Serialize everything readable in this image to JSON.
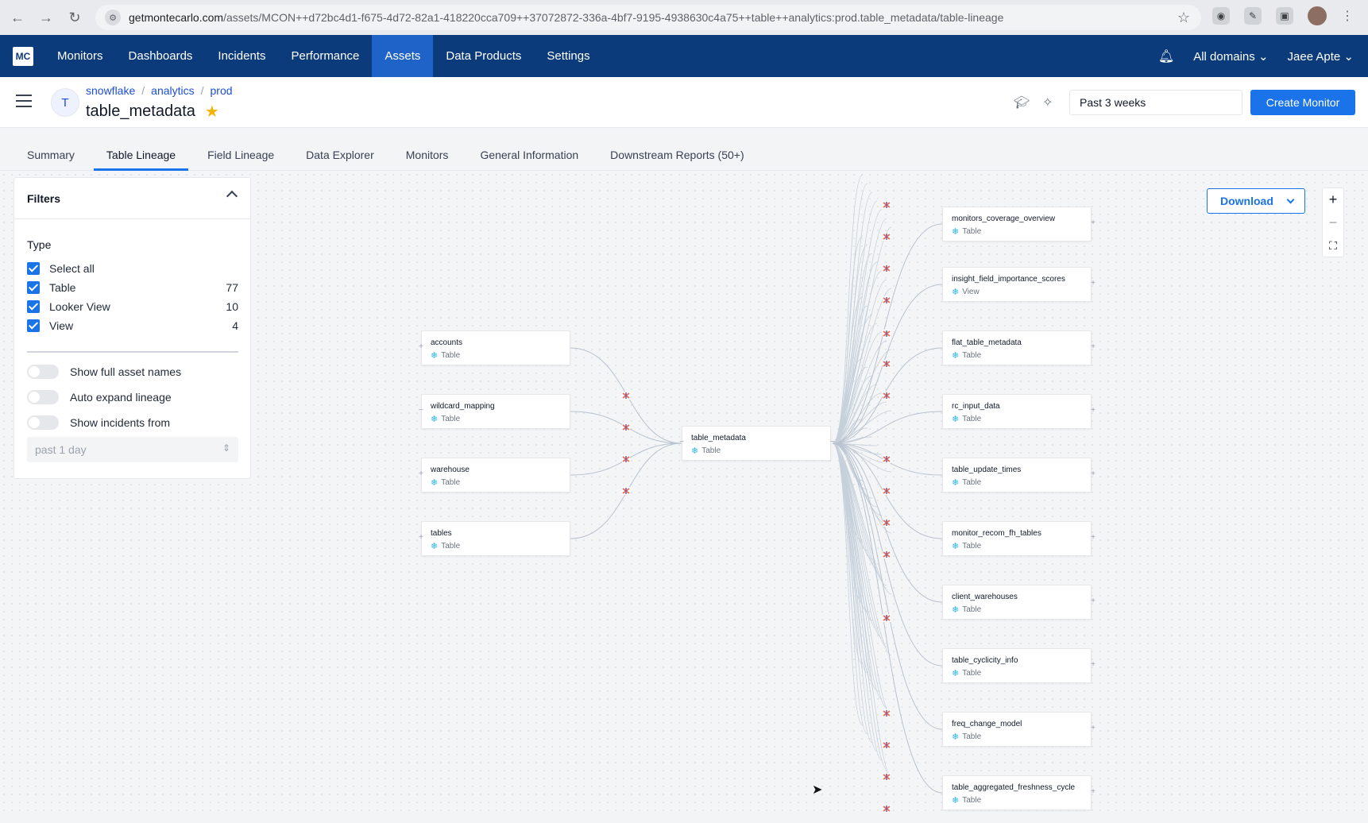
{
  "browser": {
    "url_host": "getmontecarlo.com",
    "url_path": "/assets/MCON++d72bc4d1-f675-4d72-82a1-418220cca709++37072872-336a-4bf7-9195-4938630c4a75++table++analytics:prod.table_metadata/table-lineage"
  },
  "navbar": {
    "logo": "MC",
    "items": [
      "Monitors",
      "Dashboards",
      "Incidents",
      "Performance",
      "Assets",
      "Data Products",
      "Settings"
    ],
    "active": "Assets",
    "domains": "All domains",
    "user": "Jaee Apte"
  },
  "asset": {
    "avatar": "T",
    "breadcrumb": [
      "snowflake",
      "analytics",
      "prod"
    ],
    "title": "table_metadata",
    "time_range": "Past 3 weeks",
    "create_monitor": "Create Monitor"
  },
  "tabs": [
    {
      "label": "Summary"
    },
    {
      "label": "Table Lineage"
    },
    {
      "label": "Field Lineage"
    },
    {
      "label": "Data Explorer"
    },
    {
      "label": "Monitors"
    },
    {
      "label": "General Information"
    },
    {
      "label": "Downstream Reports (50+)"
    }
  ],
  "filters": {
    "title": "Filters",
    "type_label": "Type",
    "types": [
      {
        "label": "Select all",
        "count": ""
      },
      {
        "label": "Table",
        "count": "77"
      },
      {
        "label": "Looker View",
        "count": "10"
      },
      {
        "label": "View",
        "count": "4"
      }
    ],
    "toggles": [
      "Show full asset names",
      "Auto expand lineage",
      "Show incidents from"
    ],
    "incident_range": "past 1 day"
  },
  "canvas": {
    "download": "Download",
    "zoom_in": "+",
    "zoom_out": "−",
    "fit": "⛶"
  },
  "lineage": {
    "upstream": [
      {
        "name": "accounts",
        "type": "Table"
      },
      {
        "name": "wildcard_mapping",
        "type": "Table"
      },
      {
        "name": "warehouse",
        "type": "Table"
      },
      {
        "name": "tables",
        "type": "Table"
      }
    ],
    "center": {
      "name": "table_metadata",
      "type": "Table"
    },
    "downstream": [
      {
        "name": "monitors_coverage_overview",
        "type": "Table"
      },
      {
        "name": "insight_field_importance_scores",
        "type": "View"
      },
      {
        "name": "flat_table_metadata",
        "type": "Table"
      },
      {
        "name": "rc_input_data",
        "type": "Table"
      },
      {
        "name": "table_update_times",
        "type": "Table"
      },
      {
        "name": "monitor_recom_fh_tables",
        "type": "Table"
      },
      {
        "name": "client_warehouses",
        "type": "Table"
      },
      {
        "name": "table_cyclicity_info",
        "type": "Table"
      },
      {
        "name": "freq_change_model",
        "type": "Table"
      },
      {
        "name": "table_aggregated_freshness_cycle",
        "type": "Table"
      }
    ]
  },
  "colors": {
    "navbar": "#0b3b7a",
    "nav_active": "#1f63c9",
    "primary": "#1a73e8",
    "star": "#f5b301",
    "snowflake": "#29b5e8"
  }
}
